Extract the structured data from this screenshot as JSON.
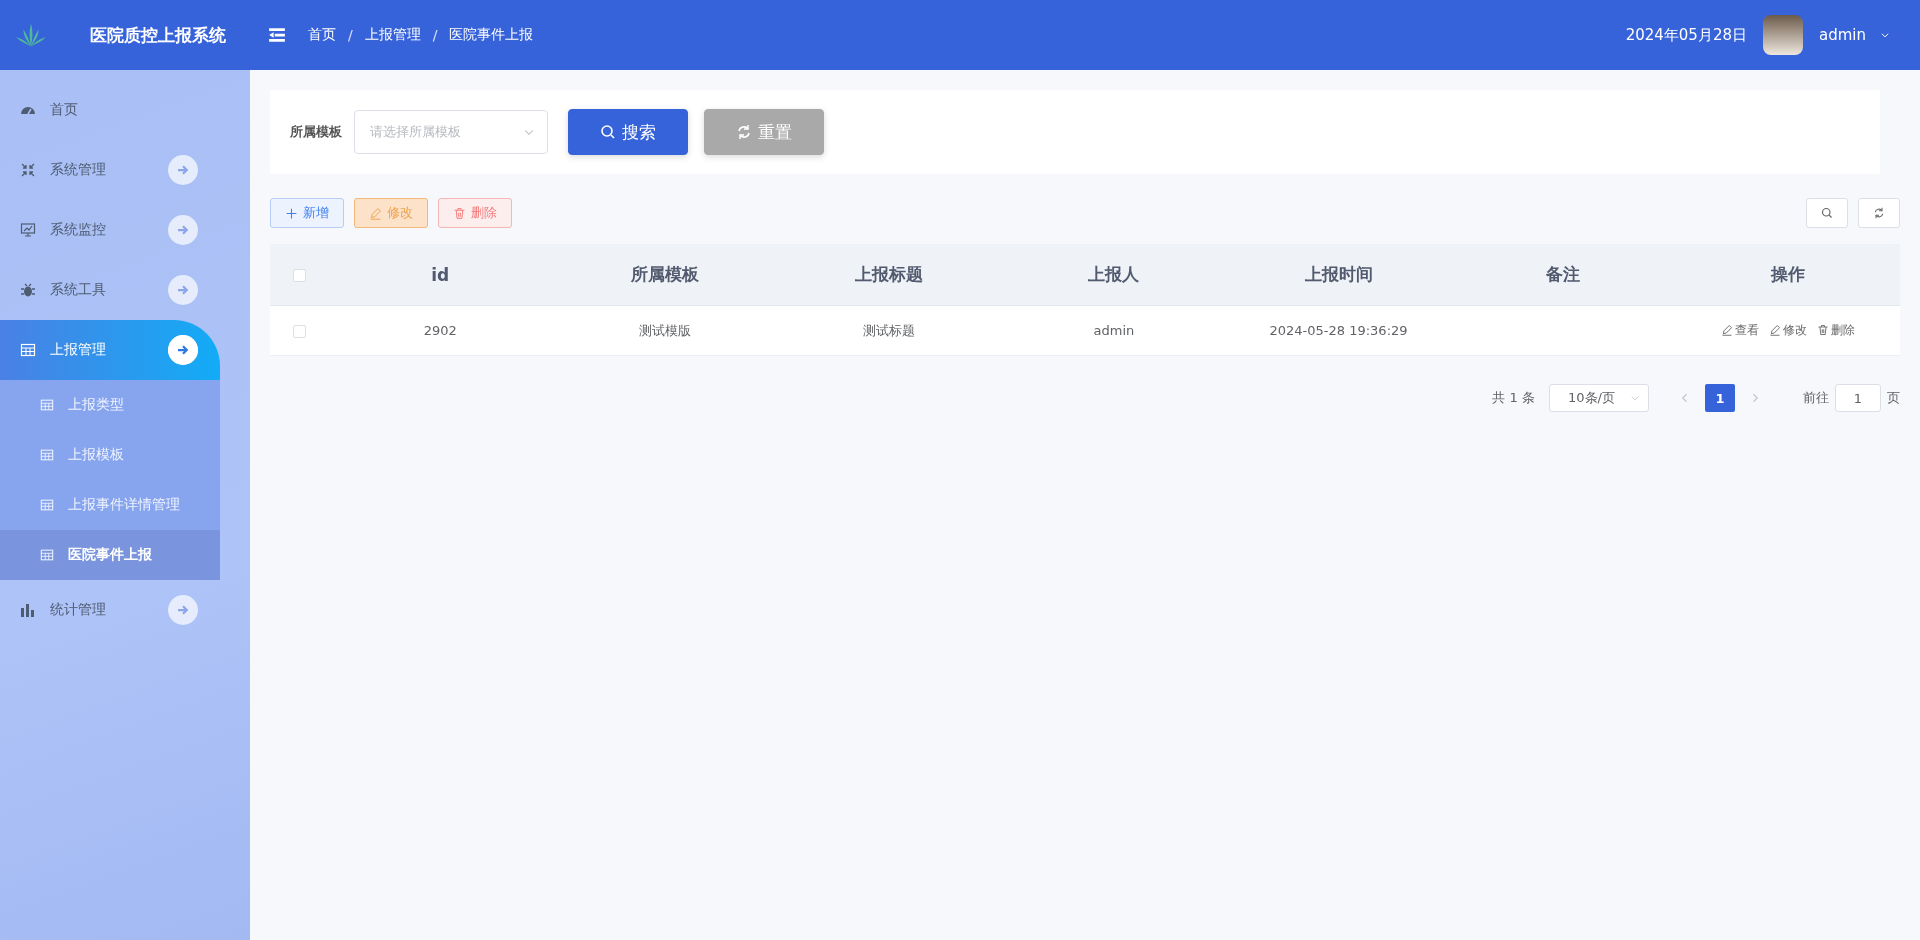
{
  "header": {
    "title": "医院质控上报系统",
    "breadcrumb": [
      {
        "label": "首页"
      },
      {
        "separator": "/",
        "label": "上报管理"
      },
      {
        "separator": "/",
        "label": "医院事件上报"
      }
    ],
    "date": "2024年05月28日",
    "user": "admin"
  },
  "sidebar": {
    "items": [
      {
        "label": "首页",
        "kind": "link",
        "selected": false
      },
      {
        "label": "系统管理",
        "kind": "submenu",
        "selected": false
      },
      {
        "label": "系统监控",
        "kind": "submenu",
        "selected": false
      },
      {
        "label": "系统工具",
        "kind": "submenu",
        "selected": false
      },
      {
        "label": "上报管理",
        "kind": "submenu",
        "selected": true,
        "children": [
          {
            "label": "上报类型",
            "selected": false
          },
          {
            "label": "上报模板",
            "selected": false
          },
          {
            "label": "上报事件详情管理",
            "selected": false
          },
          {
            "label": "医院事件上报",
            "selected": true
          }
        ]
      },
      {
        "label": "统计管理",
        "kind": "submenu",
        "selected": false
      }
    ]
  },
  "search": {
    "label": "所属模板",
    "placeholder": "请选择所属模板",
    "buttons": [
      {
        "label": "搜索",
        "kind": "search"
      },
      {
        "label": "重置",
        "kind": "reset"
      }
    ]
  },
  "toolbar": {
    "buttons": [
      {
        "label": "新增",
        "kind": "add"
      },
      {
        "label": "修改",
        "kind": "edit"
      },
      {
        "label": "删除",
        "kind": "delete"
      }
    ]
  },
  "table": {
    "all_checked": false,
    "columns": [
      "id",
      "所属模板",
      "上报标题",
      "上报人",
      "上报时间",
      "备注",
      "操作"
    ],
    "rows": [
      {
        "checked": false,
        "cells": [
          "2902",
          "测试模版",
          "测试标题",
          "admin",
          "2024-05-28 19:36:29",
          ""
        ],
        "actions": [
          {
            "label": "查看",
            "kind": "view"
          },
          {
            "label": "修改",
            "kind": "edit"
          },
          {
            "label": "删除",
            "kind": "delete"
          }
        ]
      }
    ]
  },
  "pagination": {
    "total": "共 1 条",
    "page_size": "10条/页",
    "pages": [
      {
        "label": "1",
        "selected": true
      }
    ],
    "goto_label": "前往",
    "goto_value": "1",
    "goto_suffix": "页"
  }
}
